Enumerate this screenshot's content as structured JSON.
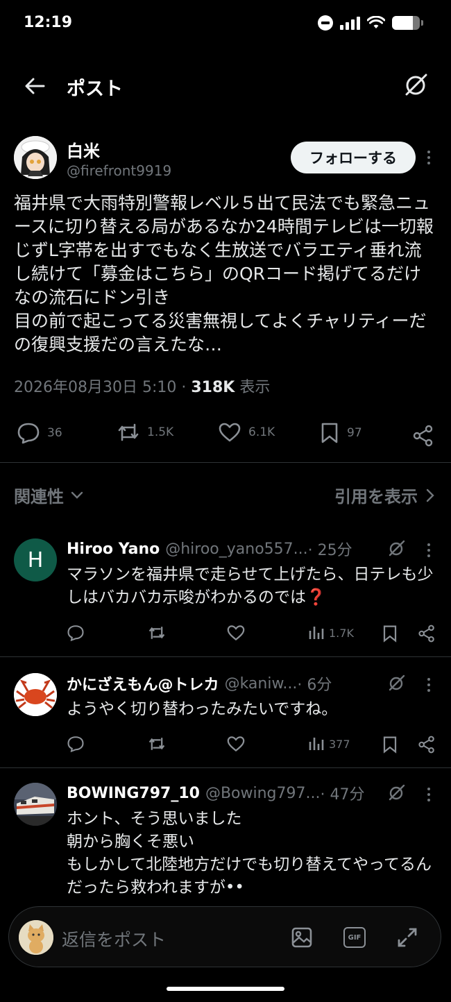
{
  "status_bar": {
    "time": "12:19",
    "battery_level": 0.75
  },
  "header": {
    "title": "ポスト"
  },
  "post": {
    "author_name": "白米",
    "author_handle": "@firefront9919",
    "follow_label": "フォローする",
    "body": "福井県で大雨特別警報レベル５出て民法でも緊急ニュースに切り替える局があるなか24時間テレビは一切報じずL字帯を出すでもなく生放送でバラエティ垂れ流し続けて「募金はこちら」のQRコード掲げてるだけなの流石にドン引き\n目の前で起こってる災害無視してよくチャリティーだの復興支援だの言えたな…",
    "timestamp": "2026年08月30日 5:10",
    "meta_separator": " · ",
    "views_count": "318K",
    "views_label": " 表示",
    "replies": "36",
    "reposts": "1.5K",
    "likes": "6.1K",
    "bookmarks": "97"
  },
  "sort": {
    "label": "関連性",
    "quotes_label": "引用を表示"
  },
  "replies": [
    {
      "name": "Hiroo Yano",
      "handle": "@hiroo_yano557...",
      "time": " · 25分",
      "avatar_letter": "H",
      "avatar_color": "#0f5a47",
      "text": "マラソンを福井県で走らせて上げたら、日テレも少しはバカバカ示唆がわかるのでは❓",
      "views": "1.7K"
    },
    {
      "name": "かにざえもん@トレカ",
      "handle": "@kaniw...",
      "time": " · 6分",
      "text": "ようやく切り替わったみたいですね。",
      "views": "377"
    },
    {
      "name": "BOWING797_10",
      "handle": "@Bowing797...",
      "time": " · 47分",
      "text": "ホント、そう思いました\n朝から胸くそ悪い\nもしかして北陸地方だけでも切り替えてやってるんだったら救われますが••"
    }
  ],
  "reply_bar": {
    "placeholder": "返信をポスト",
    "gif_label": "GIF"
  },
  "colors": {
    "background": "#000000",
    "muted": "#71767b",
    "text": "#e7e9ea",
    "divider": "#2f3336"
  }
}
